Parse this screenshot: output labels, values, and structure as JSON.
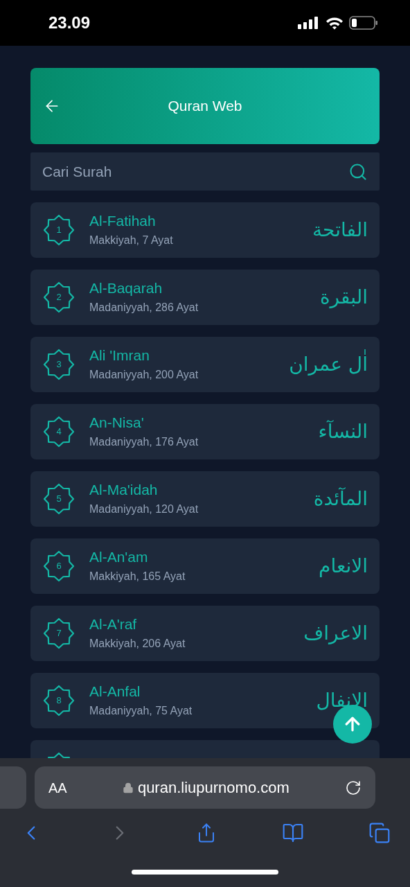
{
  "status_bar": {
    "time": "23.09"
  },
  "header": {
    "title": "Quran Web"
  },
  "search": {
    "placeholder": "Cari Surah"
  },
  "surahs": [
    {
      "number": "1",
      "name": "Al-Fatihah",
      "info": "Makkiyah, 7 Ayat",
      "arabic": "الفاتحة"
    },
    {
      "number": "2",
      "name": "Al-Baqarah",
      "info": "Madaniyyah, 286 Ayat",
      "arabic": "البقرة"
    },
    {
      "number": "3",
      "name": "Ali 'Imran",
      "info": "Madaniyyah, 200 Ayat",
      "arabic": "اٰل عمران"
    },
    {
      "number": "4",
      "name": "An-Nisa'",
      "info": "Madaniyyah, 176 Ayat",
      "arabic": "النسآء"
    },
    {
      "number": "5",
      "name": "Al-Ma'idah",
      "info": "Madaniyyah, 120 Ayat",
      "arabic": "المآئدة"
    },
    {
      "number": "6",
      "name": "Al-An'am",
      "info": "Makkiyah, 165 Ayat",
      "arabic": "الانعام"
    },
    {
      "number": "7",
      "name": "Al-A'raf",
      "info": "Makkiyah, 206 Ayat",
      "arabic": "الاعراف"
    },
    {
      "number": "8",
      "name": "Al-Anfal",
      "info": "Madaniyyah, 75 Ayat",
      "arabic": "الانفال"
    }
  ],
  "browser": {
    "text_size": "AA",
    "url": "quran.liupurnomo.com",
    "back_disabled": false,
    "forward_disabled": true
  }
}
